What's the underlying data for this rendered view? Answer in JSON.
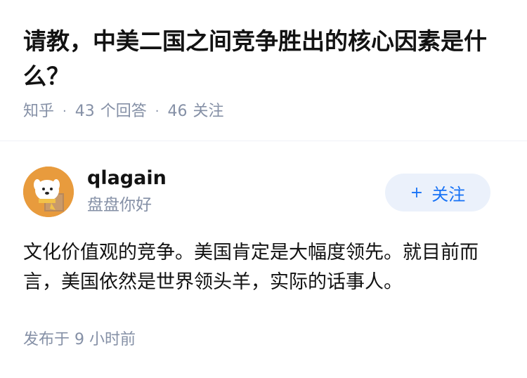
{
  "question": {
    "title": "请教，中美二国之间竞争胜出的核心因素是什么？",
    "source": "知乎",
    "answer_count": "43",
    "answer_label": "个回答",
    "follower_count": "46",
    "follower_label": "关注"
  },
  "answer": {
    "author_name": "qlagain",
    "author_bio": "盘盘你好",
    "follow_button": "关注",
    "follow_icon": "+",
    "content": "文化价值观的竞争。美国肯定是大幅度领先。就目前而言，美国依然是世界领头羊，实际的话事人。",
    "time": "发布于 9 小时前"
  },
  "colors": {
    "meta_gray": "#8590a6",
    "brand_blue": "#1772f6",
    "button_bg": "#ebf1fb"
  }
}
